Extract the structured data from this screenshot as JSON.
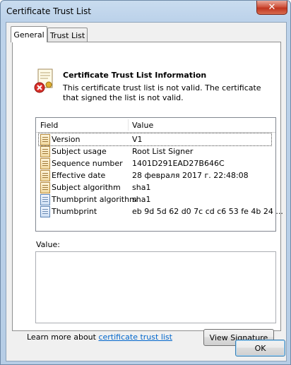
{
  "window": {
    "title": "Certificate Trust List",
    "close_glyph": "✕"
  },
  "tabs": [
    {
      "label": "General",
      "active": true
    },
    {
      "label": "Trust List",
      "active": false
    }
  ],
  "info": {
    "title": "Certificate Trust List Information",
    "message": "This certificate trust list is not valid.  The certificate that signed the list is not valid.",
    "icon": "certificate-error-icon"
  },
  "details": {
    "columns": {
      "field": "Field",
      "value": "Value"
    },
    "rows": [
      {
        "field": "Version",
        "value": "V1",
        "icon": "cert-field-icon"
      },
      {
        "field": "Subject usage",
        "value": "Root List Signer",
        "icon": "cert-field-icon"
      },
      {
        "field": "Sequence number",
        "value": "1401D291EAD27B646C",
        "icon": "cert-field-icon"
      },
      {
        "field": "Effective date",
        "value": "28 февраля 2017 г. 22:48:08",
        "icon": "cert-field-icon"
      },
      {
        "field": "Subject algorithm",
        "value": "sha1",
        "icon": "cert-field-icon"
      },
      {
        "field": "Thumbprint algorithm",
        "value": "sha1",
        "icon": "cert-property-icon"
      },
      {
        "field": "Thumbprint",
        "value": "eb 9d 5d 62 d0 7c cd c6 53 fe 4b 24 ...",
        "icon": "cert-property-icon"
      }
    ]
  },
  "value_label": "Value:",
  "footer": {
    "learn_prefix": "Learn more about ",
    "learn_link": "certificate trust list",
    "view_signature": "View Signature",
    "ok": "OK"
  }
}
